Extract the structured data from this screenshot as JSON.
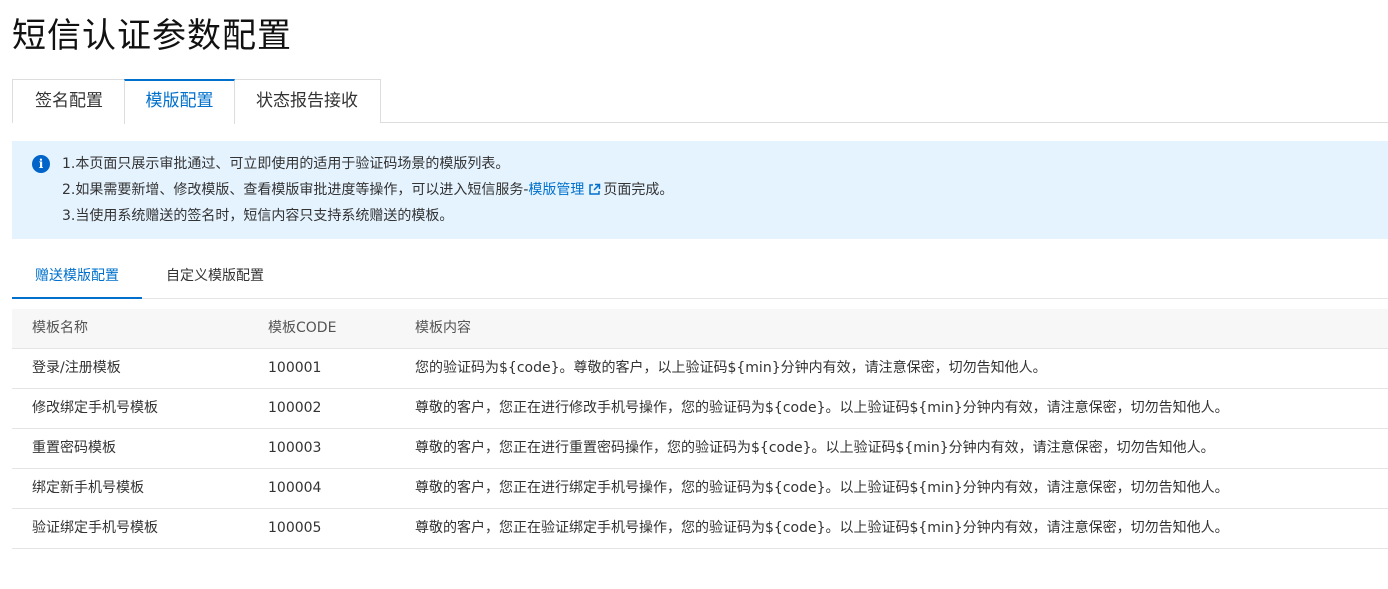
{
  "page": {
    "title": "短信认证参数配置"
  },
  "main_tabs": [
    {
      "label": "签名配置"
    },
    {
      "label": "模版配置"
    },
    {
      "label": "状态报告接收"
    }
  ],
  "notice": {
    "icon": "info-icon",
    "line1": "1.本页面只展示审批通过、可立即使用的适用于验证码场景的模版列表。",
    "line2_prefix": "2.如果需要新增、修改模版、查看模版审批进度等操作，可以进入短信服务-",
    "line2_link": "模版管理",
    "line2_suffix": "页面完成。",
    "line3": "3.当使用系统赠送的签名时，短信内容只支持系统赠送的模板。",
    "accent_color": "#0070cc",
    "background": "#e5f3ff"
  },
  "sub_tabs": [
    {
      "label": "赠送模版配置"
    },
    {
      "label": "自定义模版配置"
    }
  ],
  "table": {
    "headers": [
      "模板名称",
      "模板CODE",
      "模板内容"
    ],
    "rows": [
      [
        "登录/注册模板",
        "100001",
        "您的验证码为${code}。尊敬的客户，以上验证码${min}分钟内有效，请注意保密，切勿告知他人。"
      ],
      [
        "修改绑定手机号模板",
        "100002",
        "尊敬的客户，您正在进行修改手机号操作，您的验证码为${code}。以上验证码${min}分钟内有效，请注意保密，切勿告知他人。"
      ],
      [
        "重置密码模板",
        "100003",
        "尊敬的客户，您正在进行重置密码操作，您的验证码为${code}。以上验证码${min}分钟内有效，请注意保密，切勿告知他人。"
      ],
      [
        "绑定新手机号模板",
        "100004",
        "尊敬的客户，您正在进行绑定手机号操作，您的验证码为${code}。以上验证码${min}分钟内有效，请注意保密，切勿告知他人。"
      ],
      [
        "验证绑定手机号模板",
        "100005",
        "尊敬的客户，您正在验证绑定手机号操作，您的验证码为${code}。以上验证码${min}分钟内有效，请注意保密，切勿告知他人。"
      ]
    ]
  }
}
